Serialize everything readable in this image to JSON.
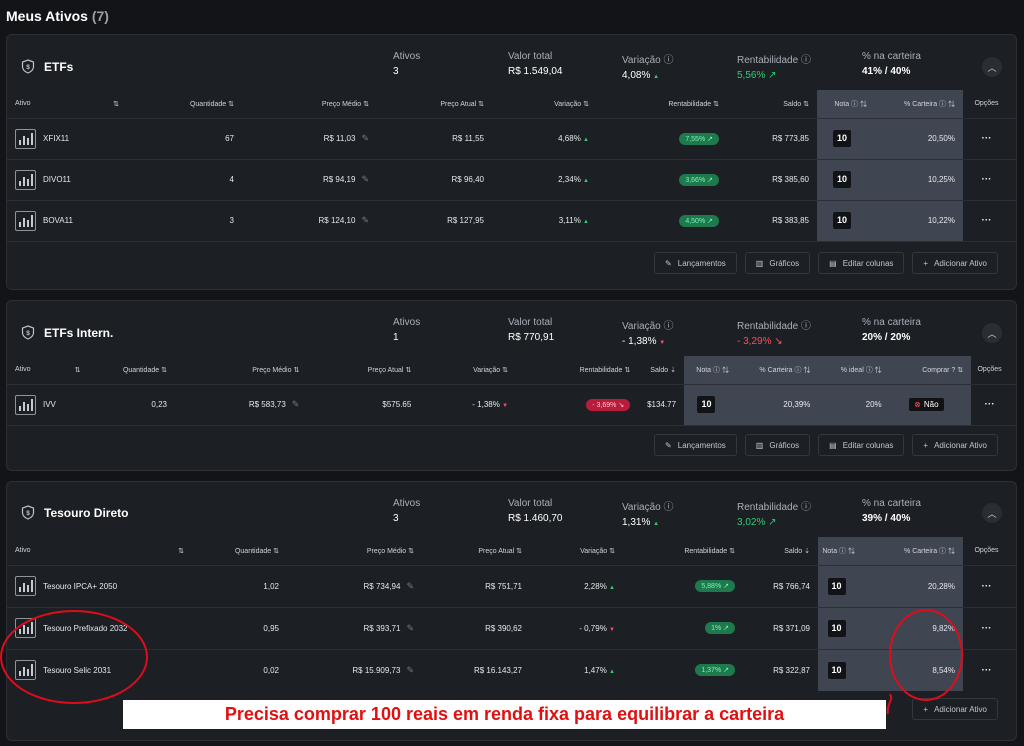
{
  "page": {
    "title": "Meus Ativos",
    "count": "(7)"
  },
  "labels": {
    "ativos": "Ativos",
    "valor_total": "Valor total",
    "variacao": "Variação",
    "rentabilidade": "Rentabilidade",
    "pct_carteira": "% na carteira"
  },
  "columns": {
    "ativo": "Ativo",
    "quantidade": "Quantidade",
    "preco_medio": "Preço Médio",
    "preco_atual": "Preço Atual",
    "variacao": "Variação",
    "rentabilidade": "Rentabilidade",
    "saldo": "Saldo",
    "nota": "Nota",
    "pct_carteira": "% Carteira",
    "pct_ideal": "% ideal",
    "comprar": "Comprar ?",
    "opcoes": "Opções"
  },
  "toolbar": {
    "lancamentos": "Lançamentos",
    "graficos": "Gráficos",
    "editar_colunas": "Editar colunas",
    "adicionar_ativo": "Adicionar Ativo"
  },
  "sections": {
    "etfs": {
      "title": "ETFs",
      "ativos": "3",
      "valor_total": "R$ 1.549,04",
      "variacao": "4,08%",
      "rentabilidade": "5,56%",
      "pct_atual": "41%",
      "pct_meta": "40%",
      "rows": [
        {
          "ativo": "XFIX11",
          "quantidade": "67",
          "preco_medio": "R$ 11,03",
          "preco_atual": "R$ 11,55",
          "variacao": "4,68%",
          "rentabilidade": "7,55%",
          "saldo": "R$ 773,85",
          "nota": "10",
          "pct_carteira": "20,50%",
          "opcoes": "···"
        },
        {
          "ativo": "DIVO11",
          "quantidade": "4",
          "preco_medio": "R$ 94,19",
          "preco_atual": "R$ 96,40",
          "variacao": "2,34%",
          "rentabilidade": "3,66%",
          "saldo": "R$ 385,60",
          "nota": "10",
          "pct_carteira": "10,25%",
          "opcoes": "···"
        },
        {
          "ativo": "BOVA11",
          "quantidade": "3",
          "preco_medio": "R$ 124,10",
          "preco_atual": "R$ 127,95",
          "variacao": "3,11%",
          "rentabilidade": "4,50%",
          "saldo": "R$ 383,85",
          "nota": "10",
          "pct_carteira": "10,22%",
          "opcoes": "···"
        }
      ]
    },
    "etfs_intern": {
      "title": "ETFs Intern.",
      "ativos": "1",
      "valor_total": "R$ 770,91",
      "variacao": "- 1,38%",
      "rentabilidade": "- 3,29%",
      "pct_atual": "20%",
      "pct_meta": "20%",
      "rows": [
        {
          "ativo": "IVV",
          "quantidade": "0,23",
          "preco_medio": "R$ 583,73",
          "preco_atual": "$575.65",
          "variacao": "- 1,38%",
          "rentabilidade": "- 3,69%",
          "saldo": "$134.77",
          "nota": "10",
          "pct_carteira": "20,39%",
          "pct_ideal": "20%",
          "comprar": "Não",
          "opcoes": "···"
        }
      ]
    },
    "tesouro": {
      "title": "Tesouro Direto",
      "ativos": "3",
      "valor_total": "R$ 1.460,70",
      "variacao": "1,31%",
      "rentabilidade": "3,02%",
      "pct_atual": "39%",
      "pct_meta": "40%",
      "rows": [
        {
          "ativo": "Tesouro IPCA+ 2050",
          "quantidade": "1,02",
          "preco_medio": "R$ 734,94",
          "preco_atual": "R$ 751,71",
          "variacao": "2,28%",
          "rentabilidade": "5,88%",
          "saldo": "R$ 766,74",
          "nota": "10",
          "pct_carteira": "20,28%",
          "opcoes": "···"
        },
        {
          "ativo": "Tesouro Prefixado 2032",
          "quantidade": "0,95",
          "preco_medio": "R$ 393,71",
          "preco_atual": "R$ 390,62",
          "variacao": "- 0,79%",
          "rentabilidade": "1%",
          "saldo": "R$ 371,09",
          "nota": "10",
          "pct_carteira": "9,82%",
          "opcoes": "···"
        },
        {
          "ativo": "Tesouro Selic 2031",
          "quantidade": "0,02",
          "preco_medio": "R$ 15.909,73",
          "preco_atual": "R$ 16.143,27",
          "variacao": "1,47%",
          "rentabilidade": "1,37%",
          "saldo": "R$ 322,87",
          "nota": "10",
          "pct_carteira": "8,54%",
          "opcoes": "···"
        }
      ]
    }
  },
  "annotation": {
    "text": "Precisa comprar 100 reais em renda fixa para equilibrar a carteira"
  },
  "colors": {
    "positive": "#2ecc71",
    "negative": "#ff4d5e",
    "highlight": "#3f4652",
    "annotation": "#e01010"
  }
}
